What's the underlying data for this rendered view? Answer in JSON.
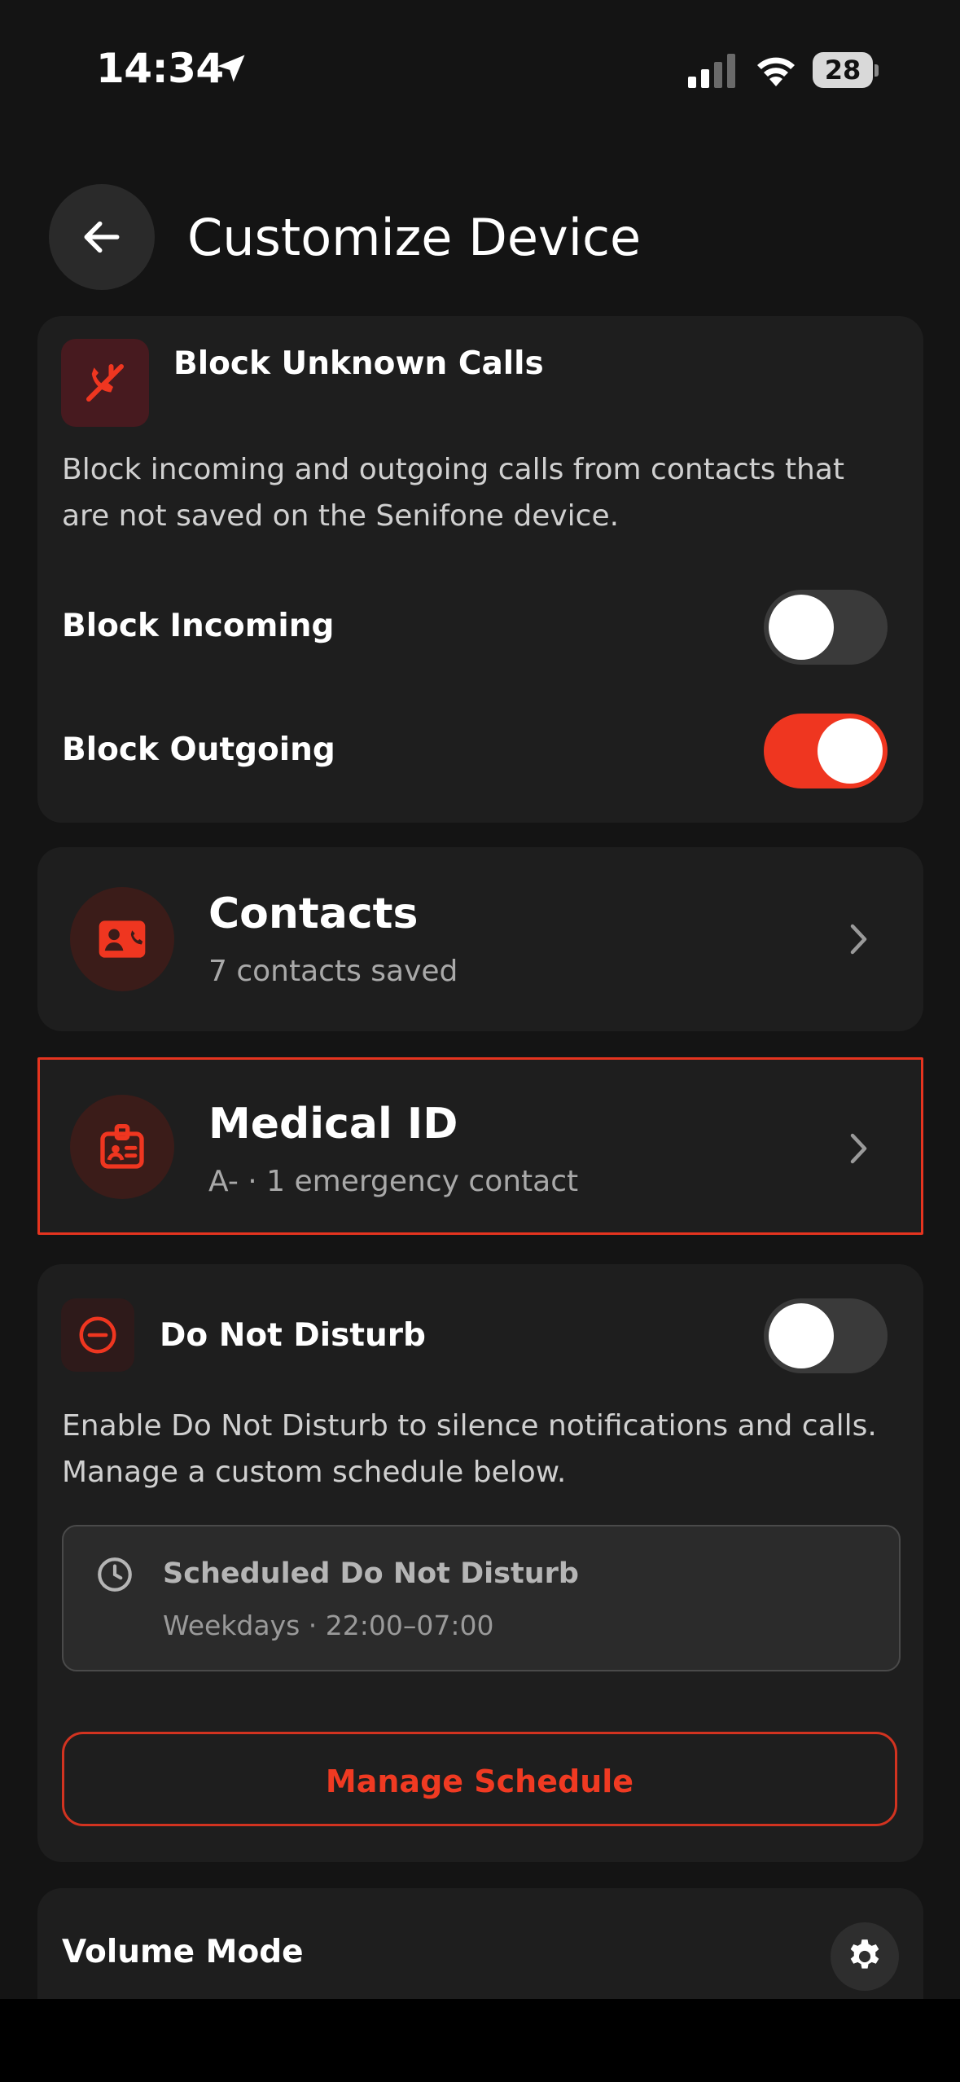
{
  "status_bar": {
    "time": "14:34",
    "battery": "28"
  },
  "header": {
    "title": "Customize Device"
  },
  "block_unknown": {
    "title": "Block Unknown Calls",
    "description_line1": "Block incoming and outgoing calls from contacts that",
    "description_line2": "are not saved on the Senifone device.",
    "incoming_label": "Block Incoming",
    "incoming_on": false,
    "outgoing_label": "Block Outgoing",
    "outgoing_on": true
  },
  "contacts": {
    "title": "Contacts",
    "subtitle": "7 contacts saved"
  },
  "medical": {
    "title": "Medical ID",
    "subtitle": "A- · 1 emergency contact"
  },
  "dnd": {
    "title": "Do Not Disturb",
    "enabled": false,
    "description_line1": "Enable Do Not Disturb to silence notifications and calls.",
    "description_line2": "Manage a custom schedule below.",
    "schedule_title": "Scheduled Do Not Disturb",
    "schedule_detail": "Weekdays · 22:00–07:00",
    "manage_label": "Manage Schedule"
  },
  "volume": {
    "title": "Volume Mode"
  },
  "colors": {
    "accent": "#ef3620",
    "background": "#141414",
    "card": "#1e1e1e"
  }
}
